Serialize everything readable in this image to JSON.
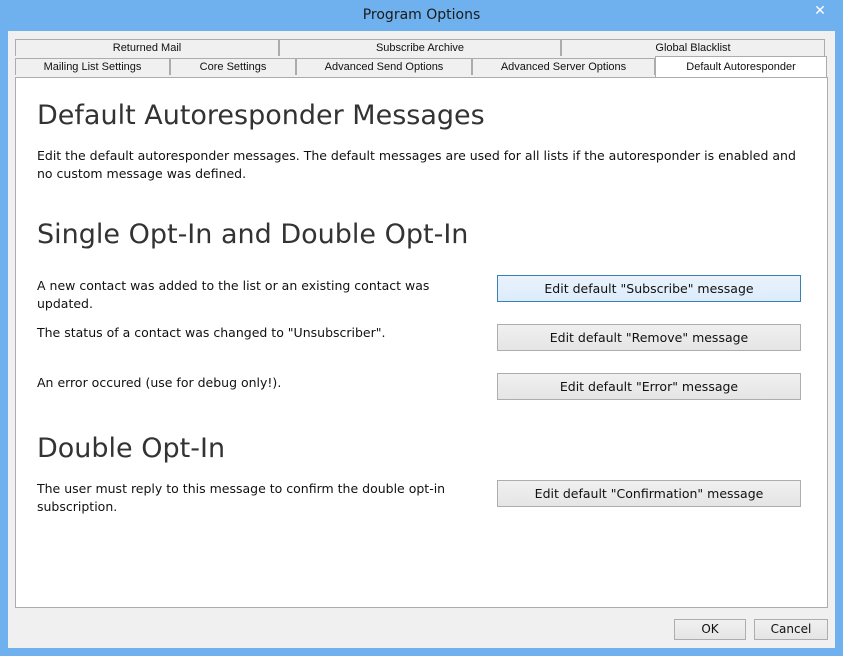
{
  "window": {
    "title": "Program Options",
    "close_symbol": "✕"
  },
  "tabs": {
    "row_top": [
      "Returned Mail",
      "Subscribe Archive",
      "Global Blacklist"
    ],
    "row_bottom": [
      "Mailing List Settings",
      "Core Settings",
      "Advanced Send Options",
      "Advanced Server Options",
      "Default Autoresponder"
    ],
    "active": "Default Autoresponder"
  },
  "content": {
    "heading": "Default Autoresponder Messages",
    "description": "Edit the default autoresponder messages. The default messages are used for all lists if the autoresponder is enabled and no custom message was defined.",
    "section_single": {
      "heading": "Single Opt-In and Double Opt-In",
      "rows": [
        {
          "text": "A new contact was added to the list or an existing contact was updated.",
          "button": "Edit default \"Subscribe\" message"
        },
        {
          "text": "The status of a contact was changed to \"Unsubscriber\".",
          "button": "Edit default \"Remove\" message"
        },
        {
          "text": "An error occured (use for debug only!).",
          "button": "Edit default \"Error\" message"
        }
      ]
    },
    "section_double": {
      "heading": "Double Opt-In",
      "rows": [
        {
          "text": "The user must reply to this message to confirm the double opt-in subscription.",
          "button": "Edit default \"Confirmation\" message"
        }
      ]
    }
  },
  "footer": {
    "ok": "OK",
    "cancel": "Cancel"
  }
}
